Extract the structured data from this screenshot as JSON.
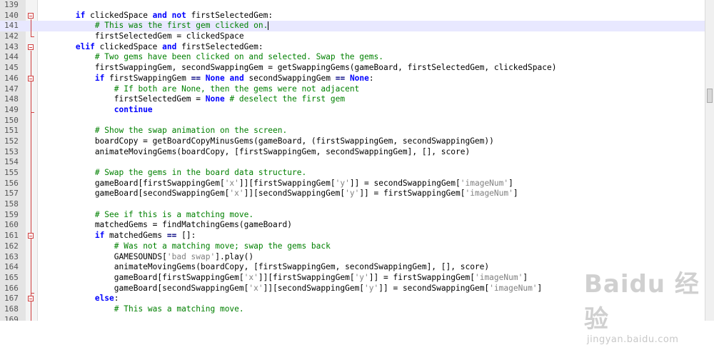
{
  "editor": {
    "lines": [
      {
        "num": "139",
        "tokens": []
      },
      {
        "num": "140",
        "tokens": [
          {
            "t": "        ",
            "c": ""
          },
          {
            "t": "if",
            "c": "kw"
          },
          {
            "t": " clickedSpace ",
            "c": ""
          },
          {
            "t": "and",
            "c": "kw"
          },
          {
            "t": " ",
            "c": ""
          },
          {
            "t": "not",
            "c": "kw"
          },
          {
            "t": " firstSelectedGem:",
            "c": ""
          }
        ]
      },
      {
        "num": "141",
        "current": true,
        "tokens": [
          {
            "t": "            ",
            "c": ""
          },
          {
            "t": "# This was the first gem clicked on.",
            "c": "cm"
          }
        ]
      },
      {
        "num": "142",
        "tokens": [
          {
            "t": "            firstSelectedGem = clickedSpace",
            "c": ""
          }
        ]
      },
      {
        "num": "143",
        "tokens": [
          {
            "t": "        ",
            "c": ""
          },
          {
            "t": "elif",
            "c": "kw"
          },
          {
            "t": " clickedSpace ",
            "c": ""
          },
          {
            "t": "and",
            "c": "kw"
          },
          {
            "t": " firstSelectedGem:",
            "c": ""
          }
        ]
      },
      {
        "num": "144",
        "tokens": [
          {
            "t": "            ",
            "c": ""
          },
          {
            "t": "# Two gems have been clicked on and selected. Swap the gems.",
            "c": "cm"
          }
        ]
      },
      {
        "num": "145",
        "tokens": [
          {
            "t": "            firstSwappingGem, secondSwappingGem = getSwappingGems(gameBoard, firstSelectedGem, clickedSpace)",
            "c": ""
          }
        ]
      },
      {
        "num": "146",
        "tokens": [
          {
            "t": "            ",
            "c": ""
          },
          {
            "t": "if",
            "c": "kw"
          },
          {
            "t": " firstSwappingGem ",
            "c": ""
          },
          {
            "t": "==",
            "c": "op"
          },
          {
            "t": " ",
            "c": ""
          },
          {
            "t": "None",
            "c": "kw"
          },
          {
            "t": " ",
            "c": ""
          },
          {
            "t": "and",
            "c": "kw"
          },
          {
            "t": " secondSwappingGem ",
            "c": ""
          },
          {
            "t": "==",
            "c": "op"
          },
          {
            "t": " ",
            "c": ""
          },
          {
            "t": "None",
            "c": "kw"
          },
          {
            "t": ":",
            "c": ""
          }
        ]
      },
      {
        "num": "147",
        "tokens": [
          {
            "t": "                ",
            "c": ""
          },
          {
            "t": "# If both are None, then the gems were not adjacent",
            "c": "cm"
          }
        ]
      },
      {
        "num": "148",
        "tokens": [
          {
            "t": "                firstSelectedGem = ",
            "c": ""
          },
          {
            "t": "None",
            "c": "kw"
          },
          {
            "t": " ",
            "c": ""
          },
          {
            "t": "# deselect the first gem",
            "c": "cm"
          }
        ]
      },
      {
        "num": "149",
        "tokens": [
          {
            "t": "                ",
            "c": ""
          },
          {
            "t": "continue",
            "c": "kw"
          }
        ]
      },
      {
        "num": "150",
        "tokens": []
      },
      {
        "num": "151",
        "tokens": [
          {
            "t": "            ",
            "c": ""
          },
          {
            "t": "# Show the swap animation on the screen.",
            "c": "cm"
          }
        ]
      },
      {
        "num": "152",
        "tokens": [
          {
            "t": "            boardCopy = getBoardCopyMinusGems(gameBoard, (firstSwappingGem, secondSwappingGem))",
            "c": ""
          }
        ]
      },
      {
        "num": "153",
        "tokens": [
          {
            "t": "            animateMovingGems(boardCopy, [firstSwappingGem, secondSwappingGem], [], score)",
            "c": ""
          }
        ]
      },
      {
        "num": "154",
        "tokens": []
      },
      {
        "num": "155",
        "tokens": [
          {
            "t": "            ",
            "c": ""
          },
          {
            "t": "# Swap the gems in the board data structure.",
            "c": "cm"
          }
        ]
      },
      {
        "num": "156",
        "tokens": [
          {
            "t": "            gameBoard[firstSwappingGem[",
            "c": ""
          },
          {
            "t": "'x'",
            "c": "st"
          },
          {
            "t": "]][firstSwappingGem[",
            "c": ""
          },
          {
            "t": "'y'",
            "c": "st"
          },
          {
            "t": "]] = secondSwappingGem[",
            "c": ""
          },
          {
            "t": "'imageNum'",
            "c": "st"
          },
          {
            "t": "]",
            "c": ""
          }
        ]
      },
      {
        "num": "157",
        "tokens": [
          {
            "t": "            gameBoard[secondSwappingGem[",
            "c": ""
          },
          {
            "t": "'x'",
            "c": "st"
          },
          {
            "t": "]][secondSwappingGem[",
            "c": ""
          },
          {
            "t": "'y'",
            "c": "st"
          },
          {
            "t": "]] = firstSwappingGem[",
            "c": ""
          },
          {
            "t": "'imageNum'",
            "c": "st"
          },
          {
            "t": "]",
            "c": ""
          }
        ]
      },
      {
        "num": "158",
        "tokens": []
      },
      {
        "num": "159",
        "tokens": [
          {
            "t": "            ",
            "c": ""
          },
          {
            "t": "# See if this is a matching move.",
            "c": "cm"
          }
        ]
      },
      {
        "num": "160",
        "tokens": [
          {
            "t": "            matchedGems = findMatchingGems(gameBoard)",
            "c": ""
          }
        ]
      },
      {
        "num": "161",
        "tokens": [
          {
            "t": "            ",
            "c": ""
          },
          {
            "t": "if",
            "c": "kw"
          },
          {
            "t": " matchedGems ",
            "c": ""
          },
          {
            "t": "==",
            "c": "op"
          },
          {
            "t": " []:",
            "c": ""
          }
        ]
      },
      {
        "num": "162",
        "tokens": [
          {
            "t": "                ",
            "c": ""
          },
          {
            "t": "# Was not a matching move; swap the gems back",
            "c": "cm"
          }
        ]
      },
      {
        "num": "163",
        "tokens": [
          {
            "t": "                GAMESOUNDS[",
            "c": ""
          },
          {
            "t": "'bad swap'",
            "c": "st"
          },
          {
            "t": "].play()",
            "c": ""
          }
        ]
      },
      {
        "num": "164",
        "tokens": [
          {
            "t": "                animateMovingGems(boardCopy, [firstSwappingGem, secondSwappingGem], [], score)",
            "c": ""
          }
        ]
      },
      {
        "num": "165",
        "tokens": [
          {
            "t": "                gameBoard[firstSwappingGem[",
            "c": ""
          },
          {
            "t": "'x'",
            "c": "st"
          },
          {
            "t": "]][firstSwappingGem[",
            "c": ""
          },
          {
            "t": "'y'",
            "c": "st"
          },
          {
            "t": "]] = firstSwappingGem[",
            "c": ""
          },
          {
            "t": "'imageNum'",
            "c": "st"
          },
          {
            "t": "]",
            "c": ""
          }
        ]
      },
      {
        "num": "166",
        "tokens": [
          {
            "t": "                gameBoard[secondSwappingGem[",
            "c": ""
          },
          {
            "t": "'x'",
            "c": "st"
          },
          {
            "t": "]][secondSwappingGem[",
            "c": ""
          },
          {
            "t": "'y'",
            "c": "st"
          },
          {
            "t": "]] = secondSwappingGem[",
            "c": ""
          },
          {
            "t": "'imageNum'",
            "c": "st"
          },
          {
            "t": "]",
            "c": ""
          }
        ]
      },
      {
        "num": "167",
        "tokens": [
          {
            "t": "            ",
            "c": ""
          },
          {
            "t": "else",
            "c": "kw"
          },
          {
            "t": ":",
            "c": ""
          }
        ]
      },
      {
        "num": "168",
        "tokens": [
          {
            "t": "                ",
            "c": ""
          },
          {
            "t": "# This was a matching move.",
            "c": "cm"
          }
        ]
      },
      {
        "num": "169",
        "tokens": []
      }
    ]
  },
  "watermark": {
    "main": "Baidu 经验",
    "sub": "jingyan.baidu.com"
  },
  "colors": {
    "keyword": "#0000ff",
    "comment": "#008000",
    "string": "#808080",
    "gutter": "#e4e4e4",
    "current_line": "#e8e8ff",
    "fold_marker": "#d04040"
  }
}
